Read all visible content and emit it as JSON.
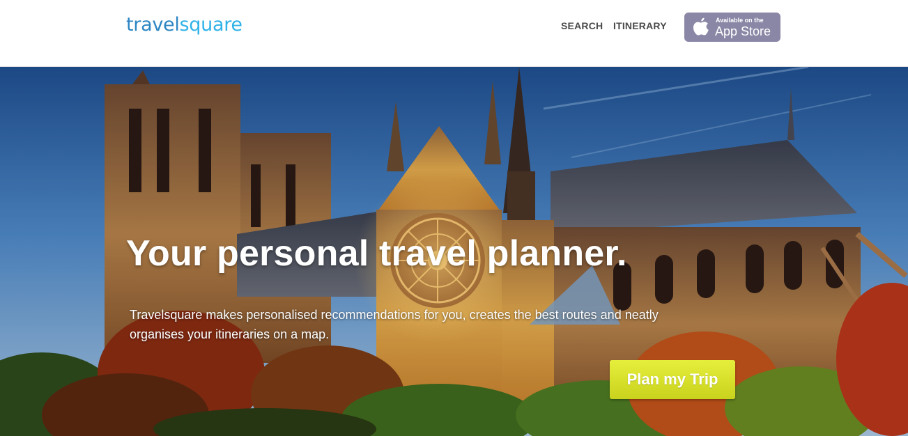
{
  "header": {
    "logo_part1": "travel",
    "logo_part2": "square",
    "nav": {
      "search": "SEARCH",
      "itinerary": "ITINERARY"
    },
    "app_store": {
      "small": "Available on the",
      "big": "App Store"
    }
  },
  "hero": {
    "headline": "Your personal travel planner.",
    "subtext": "Travelsquare makes personalised recommendations for you, creates the best routes and neatly organises your itineraries on a map.",
    "cta": "Plan my Trip"
  },
  "colors": {
    "logo_dark": "#2c86c4",
    "logo_light": "#2fb2e8",
    "app_store_bg": "#8a87a6",
    "cta": "#d8e12a",
    "nav_text": "#4a4a4a"
  },
  "icons": {
    "app_store": "apple-icon"
  }
}
